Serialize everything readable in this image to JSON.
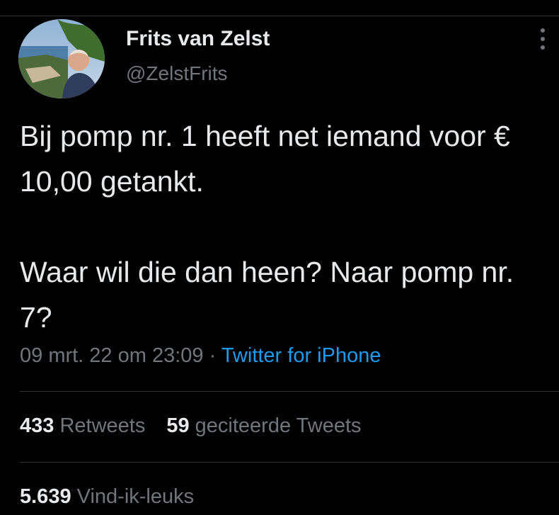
{
  "author": {
    "name": "Frits van Zelst",
    "handle": "@ZelstFrits"
  },
  "tweet": {
    "paragraphs": [
      "Bij pomp nr. 1 heeft net iemand voor € 10,00 getankt.",
      "Waar wil die dan heen? Naar pomp nr. 7?"
    ],
    "timestamp": "09 mrt. 22 om 23:09",
    "separator": "·",
    "source": "Twitter for iPhone"
  },
  "stats": {
    "retweets": {
      "count": "433",
      "label": "Retweets"
    },
    "quotes": {
      "count": "59",
      "label": "geciteerde Tweets"
    },
    "likes": {
      "count": "5.639",
      "label": "Vind-ik-leuks"
    }
  },
  "icons": {
    "more": "more-vertical-icon",
    "avatar": "profile-photo"
  },
  "colors": {
    "background": "#000000",
    "primary_text": "#e7e9ea",
    "secondary_text": "#71767b",
    "link": "#1d9bf0",
    "divider": "#2f3336"
  }
}
